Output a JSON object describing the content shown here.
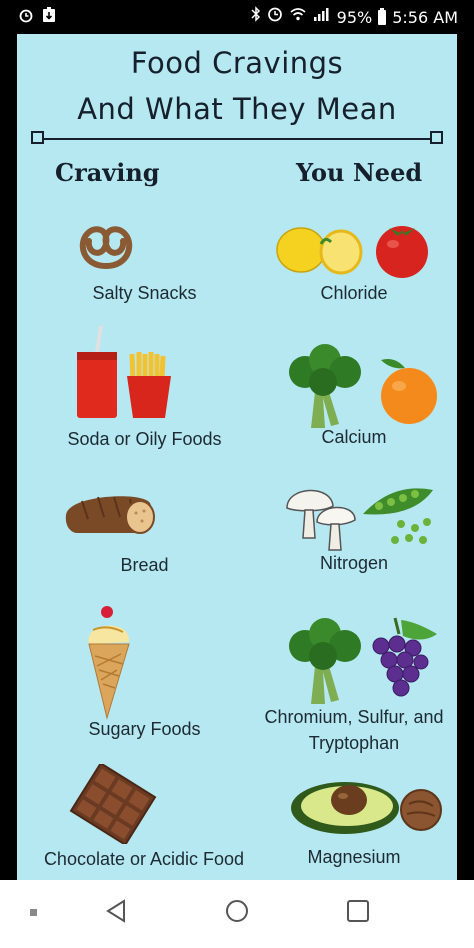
{
  "status_bar": {
    "battery": "95%",
    "time": "5:56 AM",
    "icons": [
      "alarm-icon",
      "download-icon",
      "bluetooth-icon",
      "clock-icon",
      "wifi-icon",
      "signal-icon",
      "battery-icon"
    ]
  },
  "infographic": {
    "title_line1": "Food Cravings",
    "title_line2": "And What They Mean",
    "col_craving": "Craving",
    "col_need": "You Need",
    "rows": [
      {
        "craving": "Salty Snacks",
        "need": "Chloride"
      },
      {
        "craving": "Soda or Oily Foods",
        "need": "Calcium"
      },
      {
        "craving": "Bread",
        "need": "Nitrogen"
      },
      {
        "craving": "Sugary Foods",
        "need": "Chromium, Sulfur, and Tryptophan"
      },
      {
        "craving": "Chocolate or Acidic Food",
        "need": "Magnesium"
      }
    ],
    "colors": {
      "background": "#b5e8f0",
      "text": "#16202c"
    }
  },
  "nav_bar": {
    "buttons": [
      "recent-apps-dot",
      "back-button",
      "home-button",
      "overview-button"
    ]
  }
}
